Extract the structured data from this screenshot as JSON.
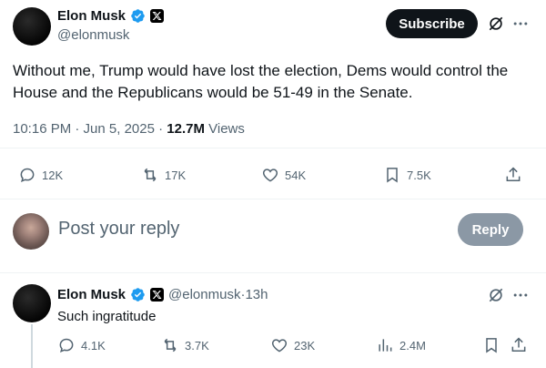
{
  "main_tweet": {
    "author_name": "Elon Musk",
    "author_handle": "@elonmusk",
    "subscribe_label": "Subscribe",
    "text_line1": "Without me, Trump would have lost the election, Dems would control the",
    "text_line2": "House and the Republicans would be 51-49 in the Senate.",
    "timestamp": "10:16 PM · Jun 5, 2025 · ",
    "views_count": "12.7M",
    "views_label": " Views",
    "actions": {
      "replies": "12K",
      "reposts": "17K",
      "likes": "54K",
      "bookmarks": "7.5K"
    }
  },
  "reply_box": {
    "placeholder": "Post your reply",
    "button_label": "Reply"
  },
  "reply_tweet": {
    "author_name": "Elon Musk",
    "author_handle": "@elonmusk",
    "separator": " · ",
    "age": "13h",
    "text": "Such ingratitude",
    "actions": {
      "replies": "4.1K",
      "reposts": "3.7K",
      "likes": "23K",
      "views": "2.4M"
    }
  },
  "colors": {
    "verified_blue": "#1d9bf0",
    "text_primary": "#0f1419",
    "text_secondary": "#536471",
    "reply_button_disabled": "#8b98a5"
  },
  "icons": [
    "verified-icon",
    "x-logo-icon",
    "grok-icon",
    "more-icon",
    "reply-icon",
    "repost-icon",
    "like-icon",
    "bookmark-icon",
    "share-icon",
    "views-icon"
  ]
}
